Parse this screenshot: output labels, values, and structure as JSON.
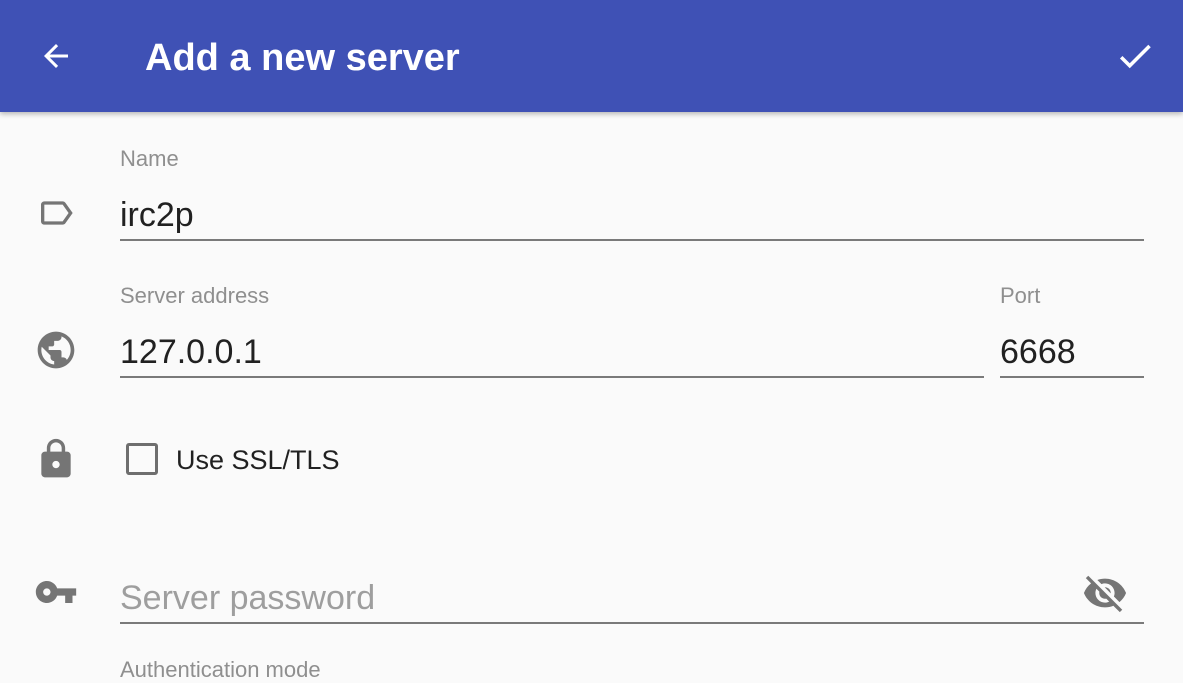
{
  "appbar": {
    "title": "Add a new server",
    "back_icon": "arrow-left-icon",
    "confirm_icon": "check-icon",
    "color": "#3f51b5"
  },
  "form": {
    "name": {
      "label": "Name",
      "value": "irc2p",
      "icon": "label-tag-icon"
    },
    "server_address": {
      "label": "Server address",
      "value": "127.0.0.1",
      "icon": "globe-icon"
    },
    "port": {
      "label": "Port",
      "value": "6668"
    },
    "ssl": {
      "label": "Use SSL/TLS",
      "checked": false,
      "icon": "lock-icon"
    },
    "password": {
      "placeholder": "Server password",
      "value": "",
      "icon": "key-icon",
      "toggle_icon": "eye-off-icon"
    },
    "auth_mode": {
      "label": "Authentication mode"
    }
  }
}
